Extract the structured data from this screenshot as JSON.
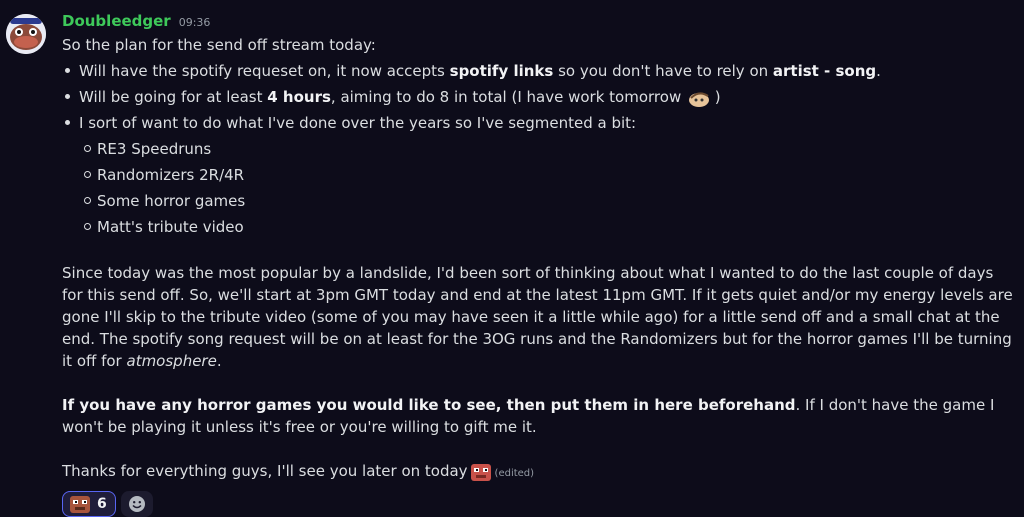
{
  "message": {
    "author": "Doubleedger",
    "time": "09:36",
    "intro": "So the plan for the send off stream today:",
    "bullets": {
      "b1": {
        "a": "Will have the spotify requeset on, it now accepts ",
        "b": "spotify links",
        "c": " so you don't have to rely on ",
        "d": "artist - song",
        "e": "."
      },
      "b2": {
        "a": "Will be going for at least ",
        "b": "4 hours",
        "c": ", aiming to do 8 in total (I have work tomorrow ",
        "d": " )"
      },
      "b3": "I sort of want to do what I've done over the years so I've segmented a bit:",
      "sub": [
        "RE3 Speedruns",
        "Randomizers 2R/4R",
        "Some horror games",
        "Matt's tribute video"
      ]
    },
    "para1": {
      "a": "Since today was the most popular by a landslide, I'd been sort of thinking about what I wanted to do the last couple of days for this send off. So, we'll start at 3pm GMT today and end at the latest 11pm GMT. If it gets quiet and/or my energy levels are gone I'll skip to the tribute video (some of you may have seen it a little while ago) for a little send off and a small chat at the end.  The spotify song request will be on at least for the 3OG runs and the Randomizers but for the horror games I'll be turning it off for ",
      "b": "atmosphere",
      "c": "."
    },
    "para2": {
      "a": "If you have any horror games you would like to see, then put them in here beforehand",
      "b": ". If I don't have the game I won't be playing it unless it's free or you're willing to gift me it."
    },
    "para3": "Thanks for everything guys, I'll see you later on today",
    "edited": "(edited)"
  },
  "reactions": [
    {
      "icon": "pixel-face-emoji",
      "count": "6"
    }
  ],
  "add_reaction_icon": "smiley-add-reaction-icon"
}
